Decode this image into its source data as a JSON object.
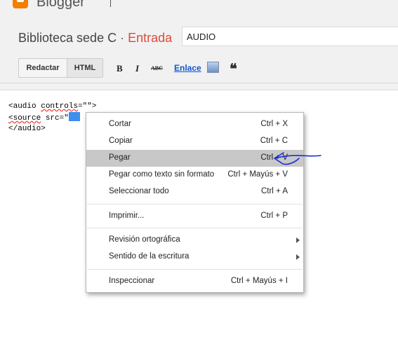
{
  "app": {
    "brand": "Blogger"
  },
  "header": {
    "blog_name": "Biblioteca sede C",
    "separator": "·",
    "section": "Entrada",
    "post_title": "AUDIO"
  },
  "toolbar": {
    "tab_compose": "Redactar",
    "tab_html": "HTML",
    "bold": "B",
    "italic": "I",
    "strike": "ABC",
    "link": "Enlace",
    "quote": "❝"
  },
  "editor": {
    "line1a": "<audio ",
    "line1b": "controls",
    "line1c": "=\"\">",
    "line2a": "<source",
    "line2b": " src=\"",
    "line3": "</audio>"
  },
  "context_menu": {
    "items": [
      {
        "label": "Cortar",
        "shortcut": "Ctrl + X"
      },
      {
        "label": "Copiar",
        "shortcut": "Ctrl + C"
      },
      {
        "label": "Pegar",
        "shortcut": "Ctrl + V"
      },
      {
        "label": "Pegar como texto sin formato",
        "shortcut": "Ctrl + Mayús + V"
      },
      {
        "label": "Seleccionar todo",
        "shortcut": "Ctrl + A"
      },
      {
        "label": "Imprimir...",
        "shortcut": "Ctrl + P"
      },
      {
        "label": "Revisión ortográfica",
        "shortcut": ""
      },
      {
        "label": "Sentido de la escritura",
        "shortcut": ""
      },
      {
        "label": "Inspeccionar",
        "shortcut": "Ctrl + Mayús + I"
      }
    ],
    "highlighted_item": "Pegar"
  },
  "colors": {
    "brand_orange": "#f57d00",
    "entry_red": "#dd4b39",
    "link_blue": "#1155cc",
    "selection_blue": "#3b8fee",
    "annotation_ink": "#1a2fd6"
  }
}
